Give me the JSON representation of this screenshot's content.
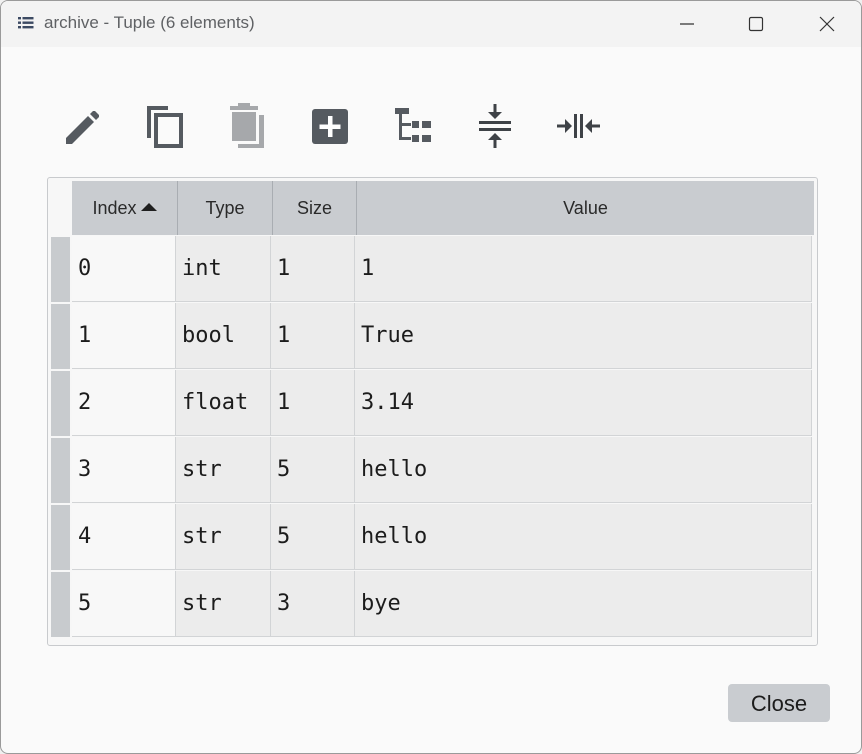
{
  "window": {
    "title": "archive - Tuple (6 elements)",
    "title_icon": "list-icon",
    "controls": [
      "minimize-icon",
      "maximize-icon",
      "close-icon"
    ]
  },
  "toolbar": {
    "buttons": [
      {
        "name": "edit",
        "icon": "pencil-icon"
      },
      {
        "name": "copy",
        "icon": "copy-icon"
      },
      {
        "name": "delete",
        "icon": "trash-icon",
        "enabled": false
      },
      {
        "name": "insert",
        "icon": "plus-icon"
      },
      {
        "name": "tree",
        "icon": "tree-icon"
      },
      {
        "name": "resize-rows",
        "icon": "rows-compress-icon"
      },
      {
        "name": "resize-columns",
        "icon": "columns-compress-icon"
      }
    ]
  },
  "table": {
    "columns": [
      "Index",
      "Type",
      "Size",
      "Value"
    ],
    "sort": {
      "column": "Index",
      "direction": "ascending"
    },
    "rows": [
      [
        "0",
        "int",
        "1",
        "1"
      ],
      [
        "1",
        "bool",
        "1",
        "True"
      ],
      [
        "2",
        "float",
        "1",
        "3.14"
      ],
      [
        "3",
        "str",
        "5",
        "hello"
      ],
      [
        "4",
        "str",
        "5",
        "hello"
      ],
      [
        "5",
        "str",
        "3",
        "bye"
      ]
    ]
  },
  "footer": {
    "close_label": "Close"
  },
  "colors": {
    "header_bg": "#c9ccd0",
    "icon": "#555a60",
    "icon_disabled": "#a6a8ab"
  }
}
